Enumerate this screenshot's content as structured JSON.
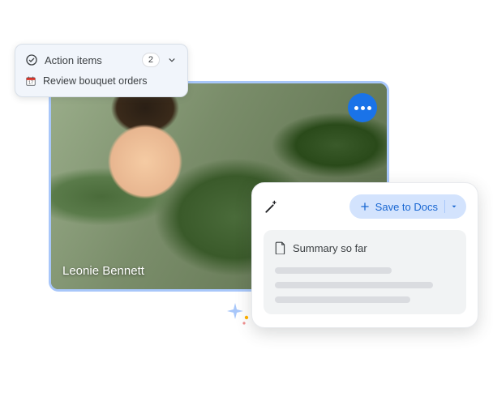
{
  "video": {
    "participant_name": "Leonie Bennett"
  },
  "action_items": {
    "title": "Action items",
    "count": "2",
    "items": [
      {
        "text": "Review bouquet orders"
      }
    ]
  },
  "summary": {
    "save_label": "Save to Docs",
    "title": "Summary so far"
  }
}
